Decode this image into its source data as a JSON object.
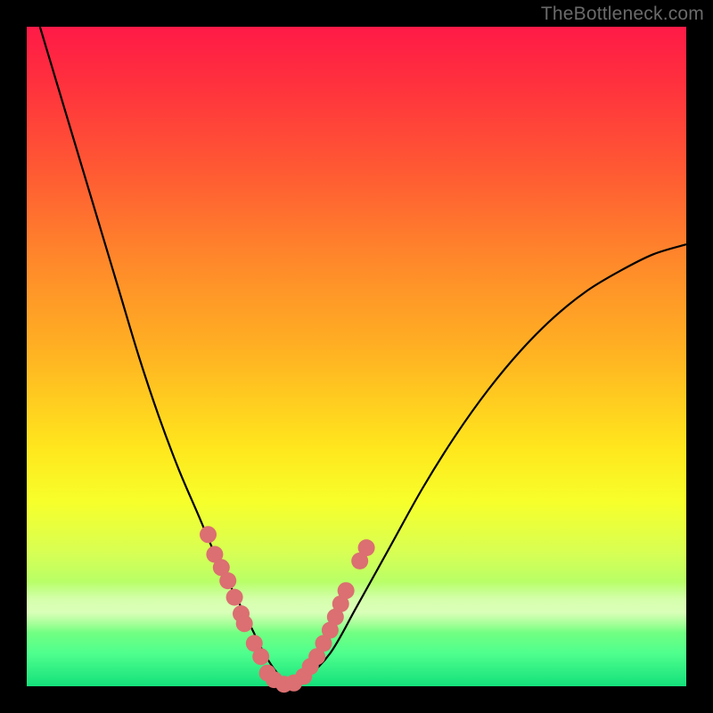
{
  "watermark": "TheBottleneck.com",
  "chart_data": {
    "type": "line",
    "title": "",
    "xlabel": "",
    "ylabel": "",
    "xlim": [
      0,
      100
    ],
    "ylim": [
      0,
      100
    ],
    "series": [
      {
        "name": "bottleneck-curve",
        "x": [
          2,
          5,
          8,
          11,
          14,
          17,
          20,
          23,
          26,
          29,
          32,
          34,
          36,
          38,
          40,
          42,
          46,
          50,
          55,
          60,
          65,
          70,
          75,
          80,
          85,
          90,
          95,
          100
        ],
        "y": [
          100,
          90,
          80,
          70,
          60,
          50,
          41,
          33,
          26,
          19,
          13,
          9,
          5,
          2,
          0.5,
          1,
          5,
          12,
          21,
          30,
          38,
          45,
          51,
          56,
          60,
          63,
          65.5,
          67
        ]
      }
    ],
    "markers": {
      "name": "highlight-dots",
      "color": "#db6f71",
      "points": [
        {
          "x": 27.5,
          "y": 23
        },
        {
          "x": 28.5,
          "y": 20
        },
        {
          "x": 29.5,
          "y": 18
        },
        {
          "x": 30.5,
          "y": 16
        },
        {
          "x": 31.5,
          "y": 13.5
        },
        {
          "x": 32.5,
          "y": 11
        },
        {
          "x": 33.0,
          "y": 9.5
        },
        {
          "x": 34.5,
          "y": 6.5
        },
        {
          "x": 35.5,
          "y": 4.5
        },
        {
          "x": 36.5,
          "y": 2.0
        },
        {
          "x": 37.5,
          "y": 1.0
        },
        {
          "x": 39.0,
          "y": 0.3
        },
        {
          "x": 40.5,
          "y": 0.5
        },
        {
          "x": 42.0,
          "y": 1.5
        },
        {
          "x": 43.0,
          "y": 3.0
        },
        {
          "x": 44.0,
          "y": 4.5
        },
        {
          "x": 45.0,
          "y": 6.5
        },
        {
          "x": 46.0,
          "y": 8.5
        },
        {
          "x": 46.8,
          "y": 10.5
        },
        {
          "x": 47.6,
          "y": 12.5
        },
        {
          "x": 48.4,
          "y": 14.5
        },
        {
          "x": 50.5,
          "y": 19.0
        },
        {
          "x": 51.5,
          "y": 21.0
        }
      ]
    },
    "gradient_stops": [
      {
        "pos": 0,
        "color": "#ff1a47"
      },
      {
        "pos": 22,
        "color": "#ff5a33"
      },
      {
        "pos": 50,
        "color": "#ffb422"
      },
      {
        "pos": 72,
        "color": "#f7ff2a"
      },
      {
        "pos": 100,
        "color": "#14e07b"
      }
    ]
  }
}
